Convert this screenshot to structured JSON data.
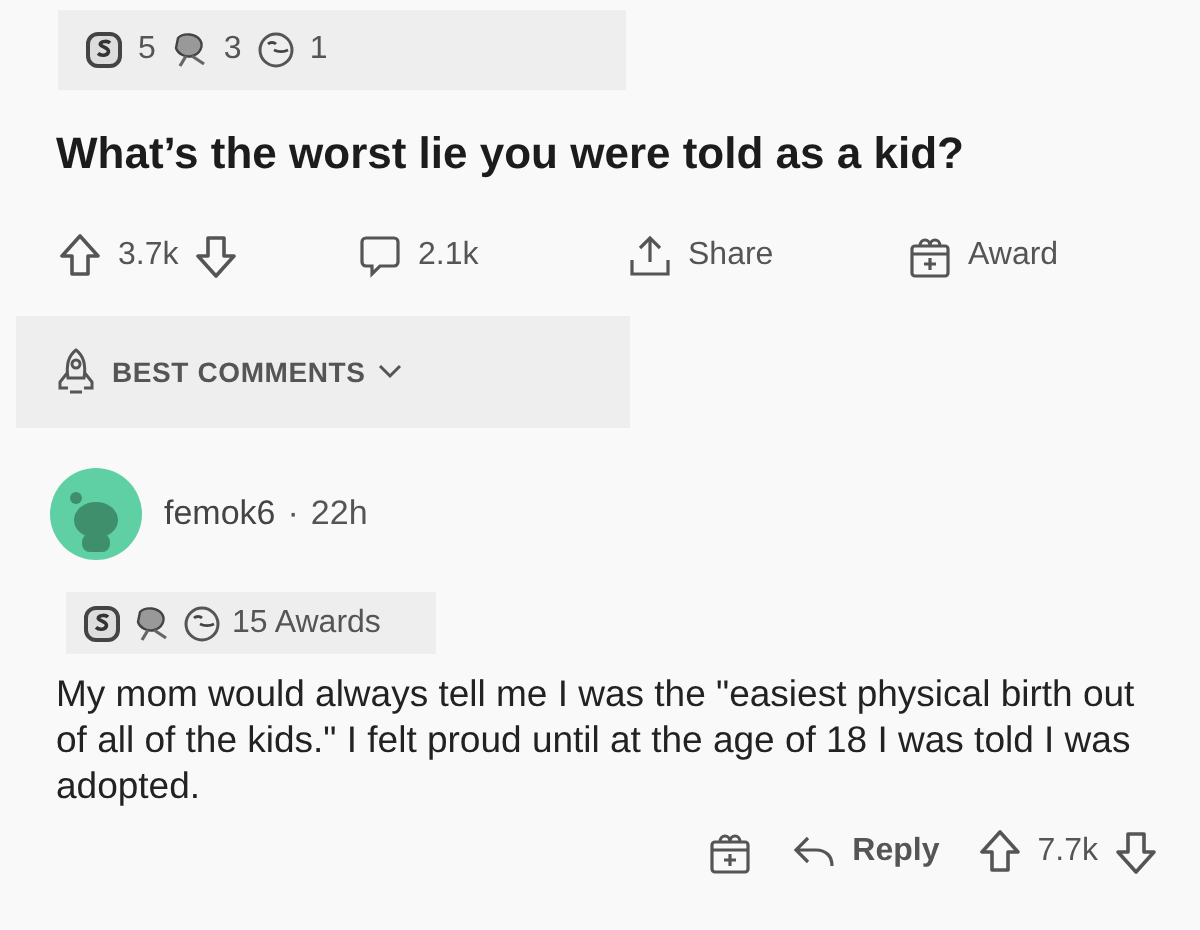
{
  "post": {
    "awards": [
      {
        "kind": "coin",
        "count": "5"
      },
      {
        "kind": "flower",
        "count": "3"
      },
      {
        "kind": "face",
        "count": "1"
      }
    ],
    "title": "What’s the worst lie you were told as a kid?",
    "votes": "3.7k",
    "comments": "2.1k",
    "share": "Share",
    "award": "Award"
  },
  "sort": {
    "label": "BEST COMMENTS"
  },
  "comment": {
    "username": "femok6",
    "separator": "·",
    "time": "22h",
    "awards": [
      {
        "kind": "coin"
      },
      {
        "kind": "flower"
      },
      {
        "kind": "face"
      }
    ],
    "awards_label": "15 Awards",
    "body": "My mom would always tell me I was the \"easiest physical birth out of all of the kids.\" I felt proud until at the age of 18 I was told I was adopted.",
    "reply": "Reply",
    "votes": "7.7k"
  }
}
